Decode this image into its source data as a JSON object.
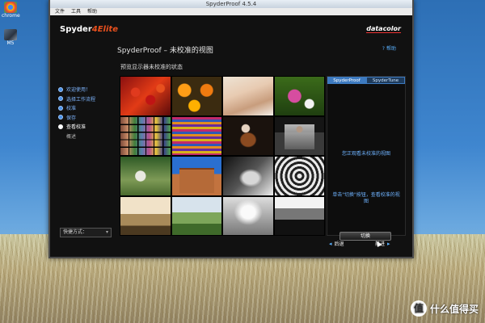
{
  "window": {
    "title": "SpyderProof 4.5.4",
    "menu": [
      "文件",
      "工具",
      "帮助"
    ]
  },
  "desktop": {
    "icons": [
      {
        "name": "chrome",
        "label": "chrome"
      },
      {
        "name": "user-folder",
        "label": "M5"
      }
    ],
    "watermark": "什么值得买"
  },
  "app": {
    "logo": "Spyder",
    "logo_suffix": "4Elite",
    "brand": "datacolor",
    "help": "帮助",
    "page_title": "SpyderProof – 未校准的视图",
    "sub_title": "预览显示器未校准的状态",
    "steps": [
      {
        "label": "欢迎使用！",
        "state": "done"
      },
      {
        "label": "选择工作流程",
        "state": "done"
      },
      {
        "label": "校准",
        "state": "done"
      },
      {
        "label": "保存",
        "state": "done"
      },
      {
        "label": "查看校准",
        "state": "active"
      },
      {
        "label": "概述",
        "state": "sub"
      }
    ],
    "shortcut_label": "快捷方式：",
    "panel": {
      "tabs": [
        "SpyderProof",
        "SpyderTune"
      ],
      "message1": "您正观看未校准的视图",
      "message2": "单击\"切换\"按钮，查看校准的视图",
      "switch_label": "切换"
    },
    "nav": {
      "back": "后退",
      "next": "前进"
    },
    "colors": {
      "accent": "#3d7ac0",
      "link": "#5ab1ff",
      "brand_red": "#e8501e"
    }
  }
}
